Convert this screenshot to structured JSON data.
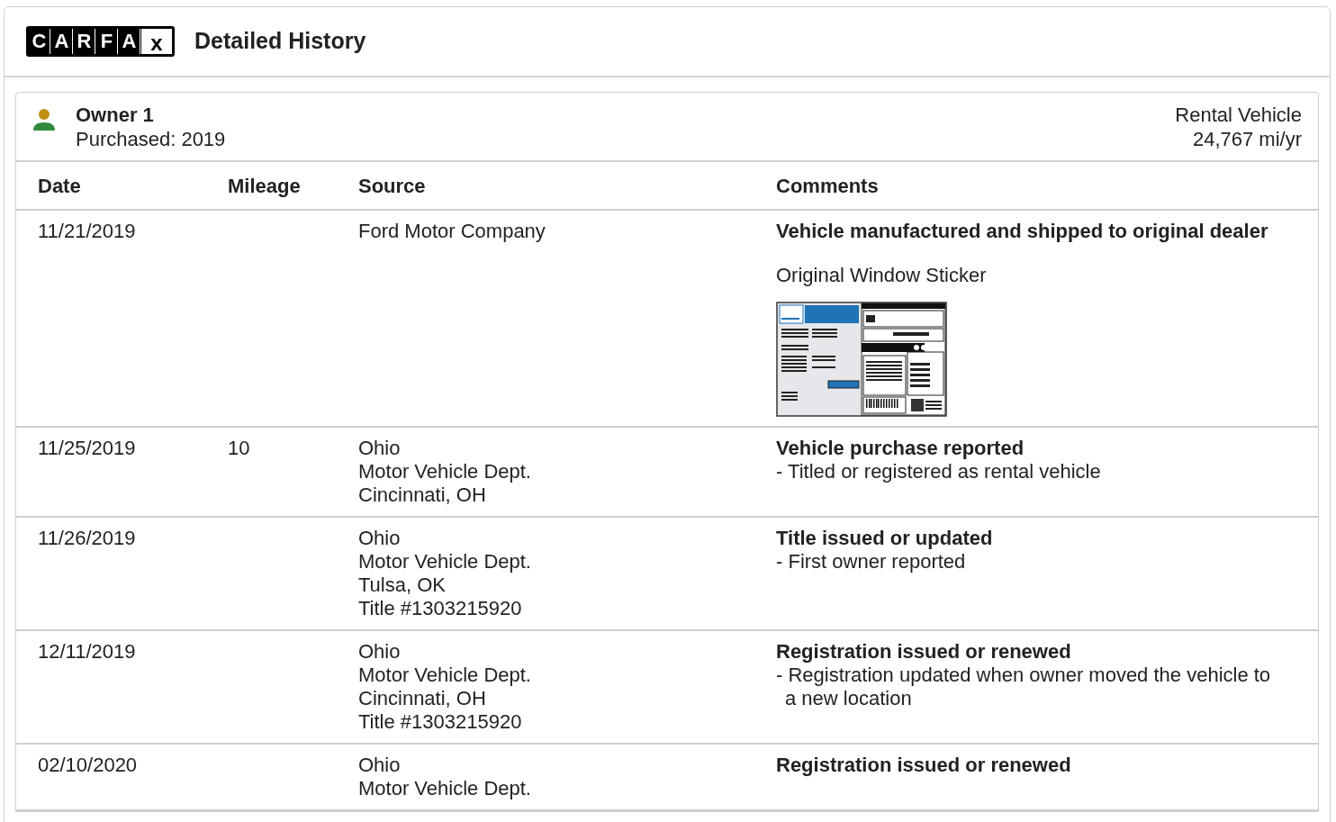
{
  "header": {
    "logo_letters": [
      "C",
      "A",
      "R",
      "F",
      "A",
      "x"
    ],
    "title": "Detailed History"
  },
  "owner": {
    "name": "Owner 1",
    "purchased": "Purchased: 2019",
    "type": "Rental Vehicle",
    "usage": "24,767 mi/yr"
  },
  "table": {
    "columns": [
      "Date",
      "Mileage",
      "Source",
      "Comments"
    ],
    "rows": [
      {
        "date": "11/21/2019",
        "mileage": "",
        "source": [
          "Ford Motor Company"
        ],
        "comment_title": "Vehicle manufactured and shipped to original dealer",
        "details": [],
        "sticker_label": "Original Window Sticker"
      },
      {
        "date": "11/25/2019",
        "mileage": "10",
        "source": [
          "Ohio",
          "Motor Vehicle Dept.",
          "Cincinnati, OH"
        ],
        "comment_title": "Vehicle purchase reported",
        "details": [
          "- Titled or registered as rental vehicle"
        ]
      },
      {
        "date": "11/26/2019",
        "mileage": "",
        "source": [
          "Ohio",
          "Motor Vehicle Dept.",
          "Tulsa, OK",
          "Title #1303215920"
        ],
        "comment_title": "Title issued or updated",
        "details": [
          "- First owner reported"
        ]
      },
      {
        "date": "12/11/2019",
        "mileage": "",
        "source": [
          "Ohio",
          "Motor Vehicle Dept.",
          "Cincinnati, OH",
          "Title #1303215920"
        ],
        "comment_title": "Registration issued or renewed",
        "details": [
          "- Registration updated when owner moved the vehicle to a new location"
        ]
      },
      {
        "date": "02/10/2020",
        "mileage": "",
        "source": [
          "Ohio",
          "Motor Vehicle Dept."
        ],
        "comment_title": "Registration issued or renewed",
        "details": []
      }
    ]
  }
}
